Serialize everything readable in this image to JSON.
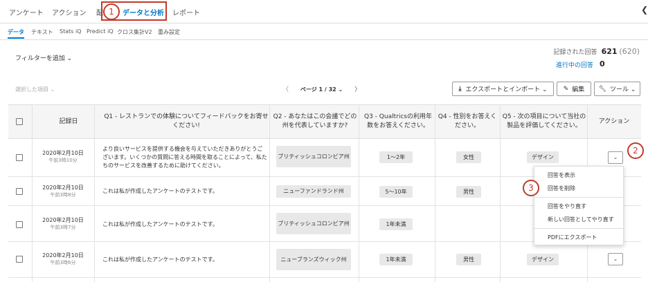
{
  "top_tabs": [
    "アンケート",
    "アクション",
    "配",
    "データと分析",
    "レポート"
  ],
  "sub_tabs": [
    "データ",
    "テキスト",
    "Stats iQ",
    "Predict iQ",
    "クロス集計V2",
    "重み設定"
  ],
  "filter_label": "フィルターを追加 ⌄",
  "recorded_label": "記録された回答",
  "recorded_count": "621",
  "recorded_total": "(620)",
  "in_progress_label": "進行中の回答",
  "in_progress_count": "0",
  "selected_items": "選択した項目 ⌄",
  "pager": {
    "prev": "〈",
    "label": "ページ 1 / 32 ⌄",
    "next": "〉"
  },
  "buttons": {
    "export": "エクスポートとインポート ⌄",
    "edit": "編集",
    "tools": "ツール ⌄"
  },
  "headers": {
    "date": "記録日",
    "q1": "Q1 - レストランでの体験についてフィードバックをお寄せください!",
    "q2": "Q2 - あなたはこの会議でどの州を代表していますか?",
    "q3": "Q3 - Qualtricsの利用年数をお答えください。",
    "q4": "Q4 - 性別をお答えください。",
    "q5": "Q5 - 次の項目について当社の製品を評価してください。",
    "action": "アクション"
  },
  "rows": [
    {
      "date": "2020年2月10日",
      "time": "午前3時10分",
      "q1": "より良いサービスを提供する機会を与えていただきありがとうございます。いくつかの質問に答える時間を取ることによって、私たちのサービスを改善するために助けてください。",
      "q2": "ブリティッシュコロンビア州",
      "q3": "1～2年",
      "q4": "女性",
      "q5": "デザイン"
    },
    {
      "date": "2020年2月10日",
      "time": "午前3時8分",
      "q1": "これは私が作成したアンケートのテストです。",
      "q2": "ニューファンドランド州",
      "q3": "5～10年",
      "q4": "男性",
      "q5": ""
    },
    {
      "date": "2020年2月10日",
      "time": "午前3時7分",
      "q1": "これは私が作成したアンケートのテストです。",
      "q2": "ブリティッシュコロンビア州",
      "q3": "1年未満",
      "q4": "",
      "q5": ""
    },
    {
      "date": "2020年2月10日",
      "time": "午前3時6分",
      "q1": "これは私が作成したアンケートのテストです。",
      "q2": "ニューブランズウィック州",
      "q3": "1年未満",
      "q4": "男性",
      "q5": "デザイン"
    }
  ],
  "menu": [
    "回答を表示",
    "回答を削除",
    "回答をやり直す",
    "新しい回答としてやり直す",
    "PDFにエクスポート"
  ],
  "markers": [
    "1",
    "2",
    "3"
  ],
  "accent_color": "#0078c8",
  "highlight_color": "#c0392b"
}
